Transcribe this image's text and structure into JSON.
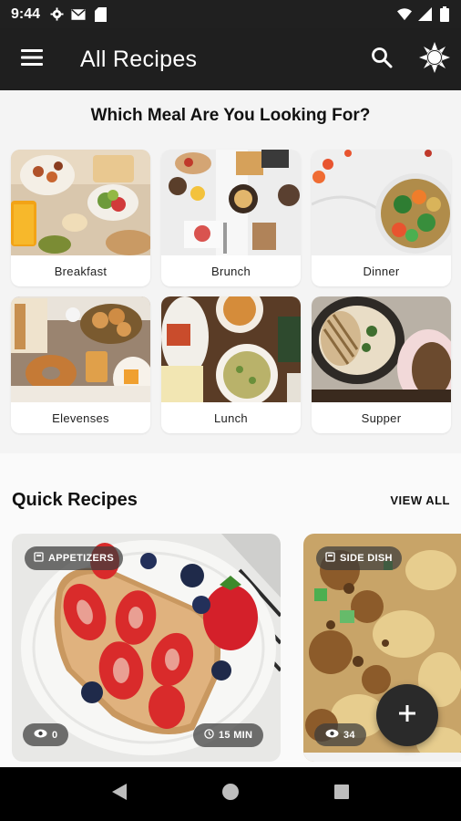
{
  "status_bar": {
    "time": "9:44",
    "left_icons": [
      "gear-icon",
      "mail-icon",
      "sd-card-icon"
    ],
    "right_icons": [
      "wifi-icon",
      "signal-icon",
      "battery-icon"
    ]
  },
  "app_bar": {
    "title": "All Recipes",
    "menu_icon": "hamburger-menu-icon",
    "actions": [
      "search-icon",
      "brightness-icon"
    ]
  },
  "meals": {
    "heading": "Which Meal Are You Looking For?",
    "items": [
      {
        "label": "Breakfast"
      },
      {
        "label": "Brunch"
      },
      {
        "label": "Dinner"
      },
      {
        "label": "Elevenses"
      },
      {
        "label": "Lunch"
      },
      {
        "label": "Supper"
      }
    ]
  },
  "quick": {
    "title": "Quick Recipes",
    "view_all": "VIEW ALL",
    "cards": [
      {
        "category": "APPETIZERS",
        "views": "0",
        "time": "15 MIN"
      },
      {
        "category": "SIDE DISH",
        "views": "34"
      }
    ]
  },
  "fab": {
    "icon": "plus-icon"
  },
  "nav": {
    "buttons": [
      "back-icon",
      "home-icon",
      "recents-icon"
    ]
  },
  "colors": {
    "app_bar": "#1f1f1f",
    "background": "#f4f4f4",
    "chip": "#3c3c3c",
    "fab": "#2a2a2a"
  }
}
